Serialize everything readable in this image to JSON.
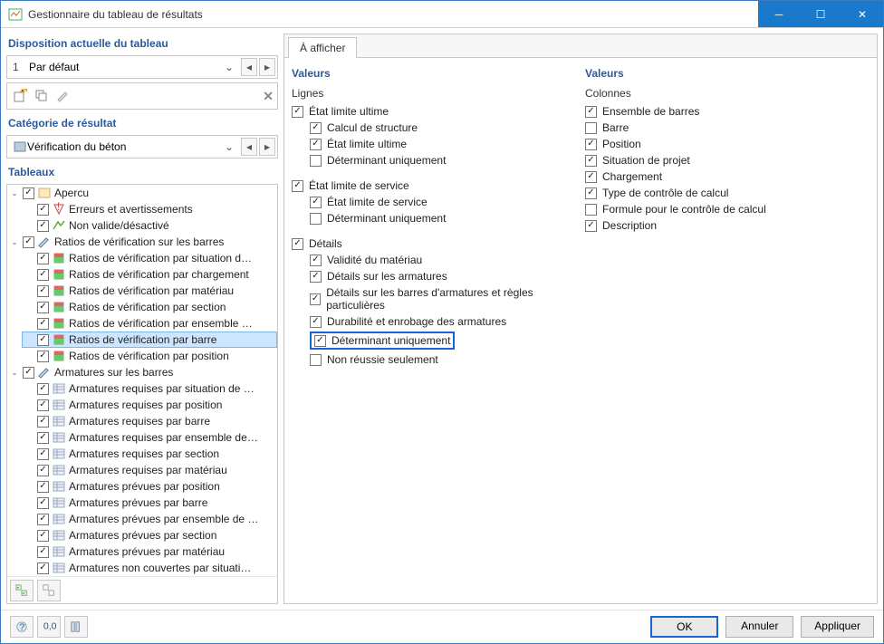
{
  "window": {
    "title": "Gestionnaire du tableau de résultats"
  },
  "left": {
    "layout_head": "Disposition actuelle du tableau",
    "layout": {
      "index": "1",
      "name": "Par défaut"
    },
    "category_head": "Catégorie de résultat",
    "category": "Vérification du béton",
    "tables_head": "Tableaux",
    "tree": [
      {
        "label": "Apercu",
        "expanded": true,
        "checked": true,
        "children": [
          {
            "label": "Erreurs et avertissements",
            "checked": true
          },
          {
            "label": "Non valide/désactivé",
            "checked": true
          }
        ]
      },
      {
        "label": "Ratios de vérification sur les barres",
        "expanded": true,
        "checked": true,
        "children": [
          {
            "label": "Ratios de vérification par situation d…",
            "checked": true
          },
          {
            "label": "Ratios de vérification par chargement",
            "checked": true
          },
          {
            "label": "Ratios de vérification par matériau",
            "checked": true
          },
          {
            "label": "Ratios de vérification par section",
            "checked": true
          },
          {
            "label": "Ratios de vérification par ensemble …",
            "checked": true
          },
          {
            "label": "Ratios de vérification par barre",
            "checked": true,
            "selected": true
          },
          {
            "label": "Ratios de vérification par position",
            "checked": true
          }
        ]
      },
      {
        "label": "Armatures sur les barres",
        "expanded": true,
        "checked": true,
        "children": [
          {
            "label": "Armatures requises par situation de …",
            "checked": true
          },
          {
            "label": "Armatures requises par position",
            "checked": true
          },
          {
            "label": "Armatures requises par barre",
            "checked": true
          },
          {
            "label": "Armatures requises par ensemble de…",
            "checked": true
          },
          {
            "label": "Armatures requises par section",
            "checked": true
          },
          {
            "label": "Armatures requises par matériau",
            "checked": true
          },
          {
            "label": "Armatures prévues par position",
            "checked": true
          },
          {
            "label": "Armatures prévues par barre",
            "checked": true
          },
          {
            "label": "Armatures prévues par ensemble de …",
            "checked": true
          },
          {
            "label": "Armatures prévues par section",
            "checked": true
          },
          {
            "label": "Armatures prévues par matériau",
            "checked": true
          },
          {
            "label": "Armatures non couvertes par situati…",
            "checked": true
          }
        ]
      }
    ]
  },
  "right": {
    "tab": "À afficher",
    "values_head": "Valeurs",
    "lines_head": "Lignes",
    "cols_head": "Colonnes",
    "lines": [
      {
        "label": "État limite ultime",
        "checked": true,
        "children": [
          {
            "label": "Calcul de structure",
            "checked": true
          },
          {
            "label": "État limite ultime",
            "checked": true
          },
          {
            "label": "Déterminant uniquement",
            "checked": false
          }
        ]
      },
      {
        "label": "État limite de service",
        "checked": true,
        "children": [
          {
            "label": "État limite de service",
            "checked": true
          },
          {
            "label": "Déterminant uniquement",
            "checked": false
          }
        ]
      },
      {
        "label": "Détails",
        "checked": true,
        "children": [
          {
            "label": "Validité du matériau",
            "checked": true
          },
          {
            "label": "Détails sur les armatures",
            "checked": true
          },
          {
            "label": "Détails sur les barres d'armatures et règles particulières",
            "checked": true
          },
          {
            "label": "Durabilité et enrobage des armatures",
            "checked": true
          },
          {
            "label": "Déterminant uniquement",
            "checked": true,
            "highlight": true
          },
          {
            "label": "Non réussie seulement",
            "checked": false
          }
        ]
      }
    ],
    "cols": [
      {
        "label": "Ensemble de barres",
        "checked": true
      },
      {
        "label": "Barre",
        "checked": false
      },
      {
        "label": "Position",
        "checked": true
      },
      {
        "label": "Situation de projet",
        "checked": true
      },
      {
        "label": "Chargement",
        "checked": true
      },
      {
        "label": "Type de contrôle de calcul",
        "checked": true
      },
      {
        "label": "Formule pour le contrôle de calcul",
        "checked": false
      },
      {
        "label": "Description",
        "checked": true
      }
    ]
  },
  "buttons": {
    "ok": "OK",
    "cancel": "Annuler",
    "apply": "Appliquer"
  }
}
